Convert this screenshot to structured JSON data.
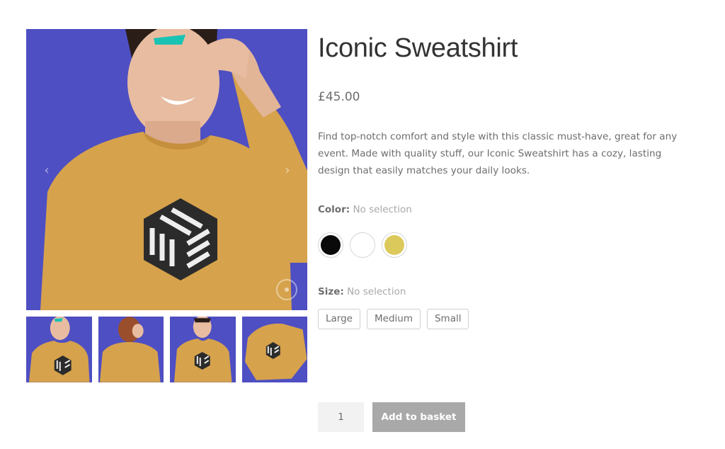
{
  "product": {
    "title": "Iconic Sweatshirt",
    "price": "£45.00",
    "description": "Find top-notch comfort and style with this classic must-have, great for any event. Made with quality stuff, our Iconic Sweatshirt has a cozy, lasting design that easily matches your daily looks."
  },
  "gallery": {
    "prev_icon": "chevron-left-icon",
    "next_icon": "chevron-right-icon",
    "prev_glyph": "‹",
    "next_glyph": "›",
    "zoom_icon": "zoom-icon",
    "thumbnail_count": 4,
    "background_color": "#4e4fc2",
    "garment_color": "#d6a24c"
  },
  "color_attribute": {
    "label": "Color",
    "separator": ":",
    "selection": "No selection",
    "swatches": [
      {
        "name": "black",
        "hex": "#0a0a0a"
      },
      {
        "name": "white",
        "hex": "#ffffff"
      },
      {
        "name": "yellow",
        "hex": "#dcc95c"
      }
    ]
  },
  "size_attribute": {
    "label": "Size",
    "separator": ":",
    "selection": "No selection",
    "options": [
      "Large",
      "Medium",
      "Small"
    ]
  },
  "cart": {
    "quantity": "1",
    "add_label": "Add to basket",
    "button_color": "#a9a9a9"
  }
}
